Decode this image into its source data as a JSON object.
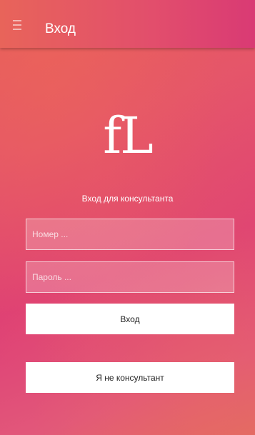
{
  "appbar": {
    "title": "Вход",
    "menu_icon": "menu-icon"
  },
  "logo": {
    "text": "fL"
  },
  "login": {
    "subtitle": "Вход для консультанта",
    "number_placeholder": "Номер ...",
    "password_placeholder": "Пароль ...",
    "login_button": "Вход",
    "not_consultant_button": "Я не консультант"
  }
}
